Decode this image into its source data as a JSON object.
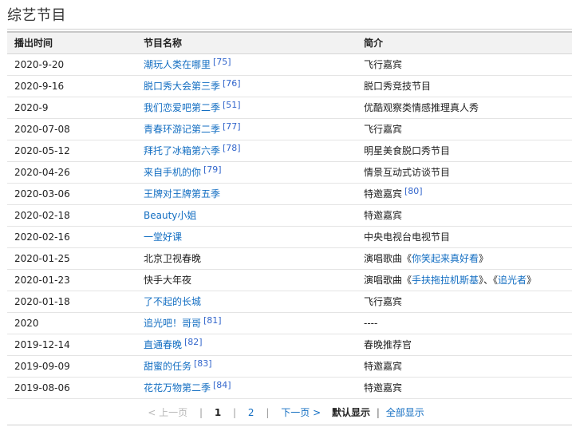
{
  "section": {
    "title": "综艺节目"
  },
  "table": {
    "headers": {
      "date": "播出时间",
      "name": "节目名称",
      "desc": "简介"
    },
    "rows": [
      {
        "date": "2020-9-20",
        "name": "潮玩人类在哪里",
        "name_link": true,
        "name_ref": "[75]",
        "desc": "飞行嘉宾"
      },
      {
        "date": "2020-9-16",
        "name": "脱口秀大会第三季",
        "name_link": true,
        "name_ref": "[76]",
        "desc": "脱口秀竞技节目"
      },
      {
        "date": "2020-9",
        "name": "我们恋爱吧第二季",
        "name_link": true,
        "name_ref": "[51]",
        "desc": "优酷观察类情感推理真人秀"
      },
      {
        "date": "2020-07-08",
        "name": "青春环游记第二季",
        "name_link": true,
        "name_ref": "[77]",
        "desc": "飞行嘉宾"
      },
      {
        "date": "2020-05-12",
        "name": "拜托了冰箱第六季",
        "name_link": true,
        "name_ref": "[78]",
        "desc": "明星美食脱口秀节目"
      },
      {
        "date": "2020-04-26",
        "name": "来自手机的你",
        "name_link": true,
        "name_ref": "[79]",
        "desc": "情景互动式访谈节目"
      },
      {
        "date": "2020-03-06",
        "name": "王牌对王牌第五季",
        "name_link": true,
        "desc": "特邀嘉宾",
        "desc_ref": "[80]"
      },
      {
        "date": "2020-02-18",
        "name": "Beauty小姐",
        "name_link": true,
        "desc": "特邀嘉宾"
      },
      {
        "date": "2020-02-16",
        "name": "一堂好课",
        "name_link": true,
        "desc": "中央电视台电视节目"
      },
      {
        "date": "2020-01-25",
        "name": "北京卫视春晚",
        "name_link": false,
        "desc_prefix": "演唱歌曲《",
        "desc_song1": "你笑起来真好看",
        "desc_suffix": "》"
      },
      {
        "date": "2020-01-23",
        "name": "快手大年夜",
        "name_link": false,
        "desc_prefix": "演唱歌曲《",
        "desc_song1": "手扶拖拉机斯基",
        "desc_mid": "》、《",
        "desc_song2": "追光者",
        "desc_suffix": "》"
      },
      {
        "date": "2020-01-18",
        "name": "了不起的长城",
        "name_link": true,
        "desc": "飞行嘉宾"
      },
      {
        "date": "2020",
        "name": "追光吧！哥哥",
        "name_link": true,
        "name_ref": "[81]",
        "desc": "----"
      },
      {
        "date": "2019-12-14",
        "name": "直通春晚",
        "name_link": true,
        "name_ref": "[82]",
        "desc": "春晚推荐官"
      },
      {
        "date": "2019-09-09",
        "name": "甜蜜的任务",
        "name_link": true,
        "name_ref": "[83]",
        "desc": "特邀嘉宾"
      },
      {
        "date": "2019-08-06",
        "name": "花花万物第二季",
        "name_link": true,
        "name_ref": "[84]",
        "desc": "特邀嘉宾"
      }
    ]
  },
  "pager": {
    "prev": "< 上一页",
    "sep": "|",
    "current": "1",
    "page2": "2",
    "next": "下一页 >",
    "default_view": "默认显示",
    "bar": "|",
    "all_view": "全部显示"
  },
  "colors": {
    "link": "#136ec2",
    "header_bg": "#f2f2f2"
  }
}
